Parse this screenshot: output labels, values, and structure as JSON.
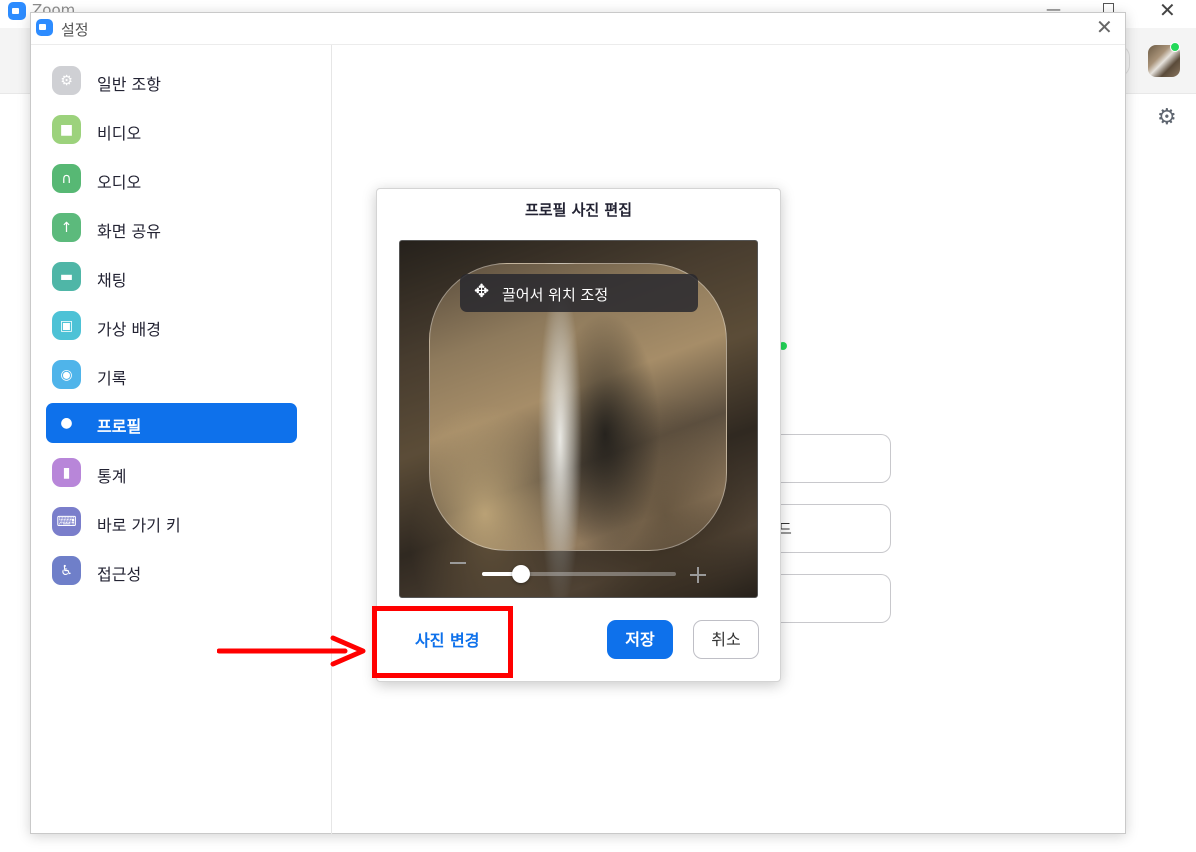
{
  "background_window": {
    "title": "Zoom"
  },
  "settings": {
    "title": "설정",
    "sidebar": [
      {
        "label": "일반 조항",
        "icon": "gear-icon",
        "color": "#cfd0d4"
      },
      {
        "label": "비디오",
        "icon": "video-camera-icon",
        "color": "#9cd27c"
      },
      {
        "label": "오디오",
        "icon": "headphones-icon",
        "color": "#57b874"
      },
      {
        "label": "화면 공유",
        "icon": "share-screen-icon",
        "color": "#5cba7c"
      },
      {
        "label": "채팅",
        "icon": "chat-bubble-icon",
        "color": "#4fb6a7"
      },
      {
        "label": "가상 배경",
        "icon": "virtual-background-icon",
        "color": "#4dc2d6"
      },
      {
        "label": "기록",
        "icon": "record-icon",
        "color": "#4fb4ea"
      },
      {
        "label": "프로필",
        "icon": "person-icon",
        "color": "#0e71eb",
        "active": true
      },
      {
        "label": "통계",
        "icon": "statistics-icon",
        "color": "#b886d9"
      },
      {
        "label": "바로 가기 키",
        "icon": "keyboard-icon",
        "color": "#7a7ecb"
      },
      {
        "label": "접근성",
        "icon": "accessibility-icon",
        "color": "#6f7fc9"
      }
    ],
    "content_ghost_text": "드"
  },
  "edit_dialog": {
    "title": "프로필 사진 편집",
    "drag_hint": "끌어서 위치 조정",
    "zoom_level": 0.2,
    "change_photo_label": "사진 변경",
    "save_label": "저장",
    "cancel_label": "취소"
  },
  "annotation": {
    "highlight_color": "#ff0000"
  }
}
